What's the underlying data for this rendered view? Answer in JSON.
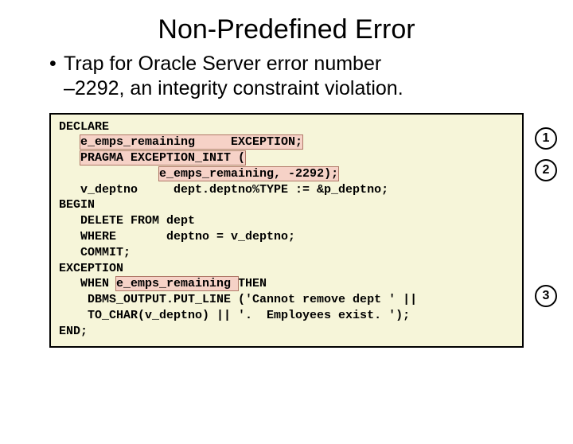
{
  "title": "Non-Predefined Error",
  "bullet": {
    "dot": "•",
    "line1": "Trap for Oracle Server error number",
    "line2": "–2292, an integrity constraint violation."
  },
  "code": {
    "l01": "DECLARE",
    "l02a": "   ",
    "l02h": "e_emps_remaining     EXCEPTION;",
    "l03a": "   ",
    "l03h": "PRAGMA EXCEPTION_INIT (",
    "l04a": "              ",
    "l04h": "e_emps_remaining, -2292);",
    "l05": "   v_deptno     dept.deptno%TYPE := &p_deptno;",
    "l06": "BEGIN",
    "l07": "   DELETE FROM dept",
    "l08": "   WHERE       deptno = v_deptno;",
    "l09": "   COMMIT;",
    "l10": "EXCEPTION",
    "l11a": "   WHEN ",
    "l11h": "e_emps_remaining ",
    "l11b": "THEN",
    "l12": "    DBMS_OUTPUT.PUT_LINE ('Cannot remove dept ' ||",
    "l13": "    TO_CHAR(v_deptno) || '.  Employees exist. ');",
    "l14": "END;"
  },
  "annotations": {
    "n1": "1",
    "n2": "2",
    "n3": "3"
  }
}
